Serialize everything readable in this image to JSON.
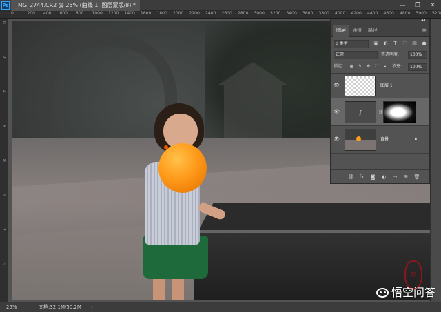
{
  "app": {
    "logo": "Ps"
  },
  "document": {
    "tab_title": "_MG_2744.CR2 @ 25% (曲线 1, 图层蒙版/8) *"
  },
  "window": {
    "minimize": "—",
    "restore": "❐",
    "close": "✕"
  },
  "ruler": {
    "top_ticks": [
      "0",
      "200",
      "400",
      "600",
      "800",
      "1000",
      "1200",
      "1400",
      "1600",
      "1800",
      "2000",
      "2200",
      "2400",
      "2600",
      "2800",
      "3000",
      "3200",
      "3400",
      "3600",
      "3800",
      "4000",
      "4200",
      "4400",
      "4600",
      "4800",
      "5000",
      "5200"
    ],
    "left_ticks": [
      "0",
      "2",
      "4",
      "6",
      "8",
      "1",
      "2",
      "3"
    ]
  },
  "layers_panel": {
    "tabs": [
      {
        "label": "图层",
        "active": true
      },
      {
        "label": "通道",
        "active": false
      },
      {
        "label": "路径",
        "active": false
      }
    ],
    "filter": {
      "label": "ρ 类型"
    },
    "blend": {
      "mode": "正常",
      "opacity_label": "不透明度:",
      "opacity": "100%"
    },
    "lock": {
      "label": "锁定:",
      "fill_label": "填充:",
      "fill": "100%"
    },
    "layers": [
      {
        "name": "图层 1"
      },
      {
        "name": ""
      },
      {
        "name": "背景"
      }
    ]
  },
  "status": {
    "zoom": "25%",
    "doc_info": "文档:32.1M/50.2M",
    "arrow": "›"
  },
  "watermark": {
    "text": "悟空问答"
  },
  "colors": {
    "accent": "#31a8ff",
    "panel_bg": "#535353",
    "balloon": "#ff9a1a"
  }
}
